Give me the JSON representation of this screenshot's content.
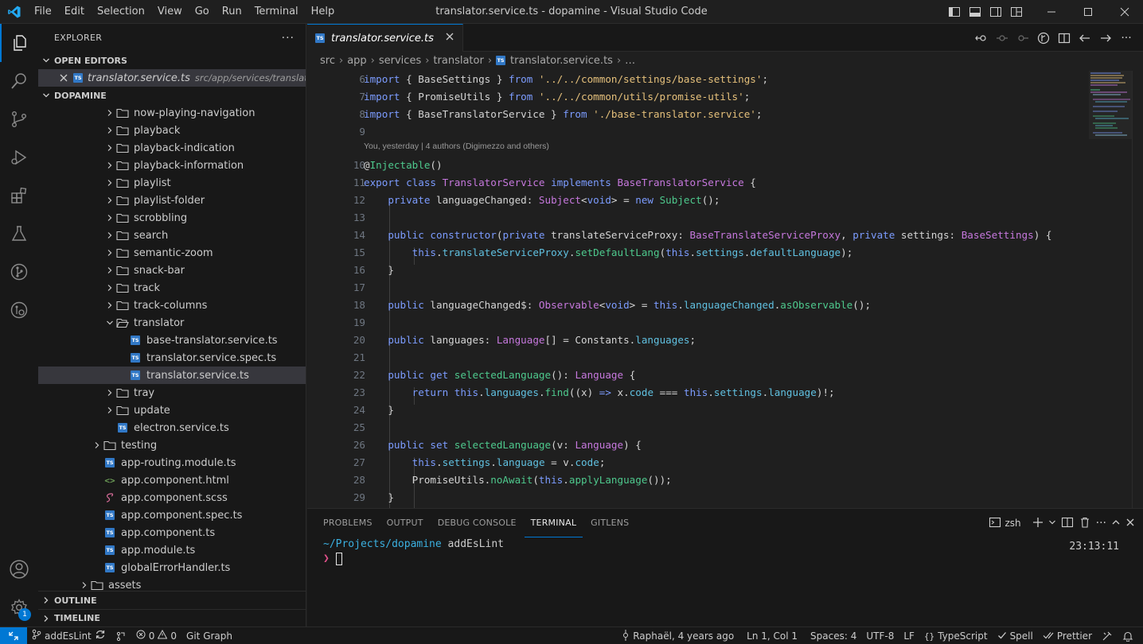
{
  "window": {
    "title": "translator.service.ts - dopamine - Visual Studio Code",
    "menu": [
      "File",
      "Edit",
      "Selection",
      "View",
      "Go",
      "Run",
      "Terminal",
      "Help"
    ]
  },
  "sidebar": {
    "title": "EXPLORER",
    "more": "···",
    "open_editors_label": "OPEN EDITORS",
    "open_editor": {
      "name": "translator.service.ts",
      "path": "src/app/services/translator"
    },
    "project_label": "DOPAMINE",
    "tree": [
      {
        "label": "now-playing-navigation",
        "kind": "folder"
      },
      {
        "label": "playback",
        "kind": "folder"
      },
      {
        "label": "playback-indication",
        "kind": "folder"
      },
      {
        "label": "playback-information",
        "kind": "folder"
      },
      {
        "label": "playlist",
        "kind": "folder"
      },
      {
        "label": "playlist-folder",
        "kind": "folder"
      },
      {
        "label": "scrobbling",
        "kind": "folder"
      },
      {
        "label": "search",
        "kind": "folder"
      },
      {
        "label": "semantic-zoom",
        "kind": "folder"
      },
      {
        "label": "snack-bar",
        "kind": "folder"
      },
      {
        "label": "track",
        "kind": "folder"
      },
      {
        "label": "track-columns",
        "kind": "folder"
      },
      {
        "label": "translator",
        "kind": "folder-open"
      },
      {
        "label": "base-translator.service.ts",
        "kind": "ts"
      },
      {
        "label": "translator.service.spec.ts",
        "kind": "ts"
      },
      {
        "label": "translator.service.ts",
        "kind": "ts"
      },
      {
        "label": "tray",
        "kind": "folder"
      },
      {
        "label": "update",
        "kind": "folder"
      },
      {
        "label": "electron.service.ts",
        "kind": "ts"
      },
      {
        "label": "testing",
        "kind": "folder"
      },
      {
        "label": "app-routing.module.ts",
        "kind": "ts"
      },
      {
        "label": "app.component.html",
        "kind": "html"
      },
      {
        "label": "app.component.scss",
        "kind": "scss"
      },
      {
        "label": "app.component.spec.ts",
        "kind": "ts"
      },
      {
        "label": "app.component.ts",
        "kind": "ts"
      },
      {
        "label": "app.module.ts",
        "kind": "ts"
      },
      {
        "label": "globalErrorHandler.ts",
        "kind": "ts"
      },
      {
        "label": "assets",
        "kind": "folder"
      }
    ],
    "outline_label": "OUTLINE",
    "timeline_label": "TIMELINE"
  },
  "editor": {
    "tab_label": "translator.service.ts",
    "breadcrumb": [
      "src",
      "app",
      "services",
      "translator",
      "translator.service.ts",
      "…"
    ],
    "blame": "You, yesterday | 4 authors (Digimezzo and others)",
    "line_numbers": [
      "6",
      "7",
      "8",
      "9",
      "10",
      "11",
      "12",
      "13",
      "14",
      "15",
      "16",
      "17",
      "18",
      "19",
      "20",
      "21",
      "22",
      "23",
      "24",
      "25",
      "26",
      "27",
      "28",
      "29"
    ],
    "lines": {
      "l6a": "import",
      "l6b": " { BaseSettings } ",
      "l6c": "from",
      "l6d": " '../../common/settings/base-settings'",
      "l6e": ";",
      "l7a": "import",
      "l7b": " { PromiseUtils } ",
      "l7c": "from",
      "l7d": " '../../common/utils/promise-utils'",
      "l7e": ";",
      "l8a": "import",
      "l8b": " { BaseTranslatorService } ",
      "l8c": "from",
      "l8d": " './base-translator.service'",
      "l8e": ";",
      "l10a": "@",
      "l10b": "Injectable",
      "l10c": "()",
      "l11a": "export",
      "l11b": " class ",
      "l11c": "TranslatorService",
      "l11d": " implements ",
      "l11e": "BaseTranslatorService",
      "l11f": " {",
      "l12a": "private",
      "l12b": " languageChanged: ",
      "l12c": "Subject",
      "l12d": "<",
      "l12e": "void",
      "l12f": "> = ",
      "l12g": "new",
      "l12h": " Subject",
      "l12i": "();",
      "l14a": "public",
      "l14b": " constructor",
      "l14c": "(",
      "l14d": "private",
      "l14e": " translateServiceProxy: ",
      "l14f": "BaseTranslateServiceProxy",
      "l14g": ", ",
      "l14h": "private",
      "l14i": " settings: ",
      "l14j": "BaseSettings",
      "l14k": ") {",
      "l15a": "this",
      "l15b": ".",
      "l15c": "translateServiceProxy",
      "l15d": ".",
      "l15e": "setDefaultLang",
      "l15f": "(",
      "l15g": "this",
      "l15h": ".",
      "l15i": "settings",
      "l15j": ".",
      "l15k": "defaultLanguage",
      "l15l": ");",
      "l16a": "}",
      "l18a": "public",
      "l18b": " languageChanged$: ",
      "l18c": "Observable",
      "l18d": "<",
      "l18e": "void",
      "l18f": "> = ",
      "l18g": "this",
      "l18h": ".",
      "l18i": "languageChanged",
      "l18j": ".",
      "l18k": "asObservable",
      "l18l": "();",
      "l20a": "public",
      "l20b": " languages: ",
      "l20c": "Language",
      "l20d": "[] = Constants.",
      "l20e": "languages",
      "l20f": ";",
      "l22a": "public",
      "l22b": " get ",
      "l22c": "selectedLanguage",
      "l22d": "(): ",
      "l22e": "Language",
      "l22f": " {",
      "l23a": "return",
      "l23b": " this",
      "l23c": ".",
      "l23d": "languages",
      "l23e": ".",
      "l23f": "find",
      "l23g": "((x) ",
      "l23h": "=>",
      "l23i": " x.",
      "l23j": "code",
      "l23k": " === ",
      "l23l": "this",
      "l23m": ".",
      "l23n": "settings",
      "l23o": ".",
      "l23p": "language",
      "l23q": ")!;",
      "l24a": "}",
      "l26a": "public",
      "l26b": " set ",
      "l26c": "selectedLanguage",
      "l26d": "(v: ",
      "l26e": "Language",
      "l26f": ") {",
      "l27a": "this",
      "l27b": ".",
      "l27c": "settings",
      "l27d": ".",
      "l27e": "language",
      "l27f": " = v.",
      "l27g": "code",
      "l27h": ";",
      "l28a": "PromiseUtils.",
      "l28b": "noAwait",
      "l28c": "(",
      "l28d": "this",
      "l28e": ".",
      "l28f": "applyLanguage",
      "l28g": "());",
      "l29a": "}"
    }
  },
  "panel": {
    "tabs": [
      "PROBLEMS",
      "OUTPUT",
      "DEBUG CONSOLE",
      "TERMINAL",
      "GITLENS"
    ],
    "active_tab": "TERMINAL",
    "shell": "zsh",
    "terminal": {
      "path": "~/Projects/dopamine",
      "branch": " addEsLint",
      "time": "23:13:11",
      "prompt": "❯"
    }
  },
  "statusbar": {
    "branch": "addEsLint",
    "errors": "0",
    "warnings": "0",
    "git_graph": "Git Graph",
    "blame": "Raphaël, 4 years ago",
    "position": "Ln 1, Col 1",
    "spaces": "Spaces: 4",
    "encoding": "UTF-8",
    "eol": "LF",
    "language": "TypeScript",
    "spell": "Spell",
    "prettier": "Prettier"
  },
  "activity_badge": "1",
  "colors": {
    "accent": "#0078d4",
    "ts_badge": "#3178c6"
  }
}
